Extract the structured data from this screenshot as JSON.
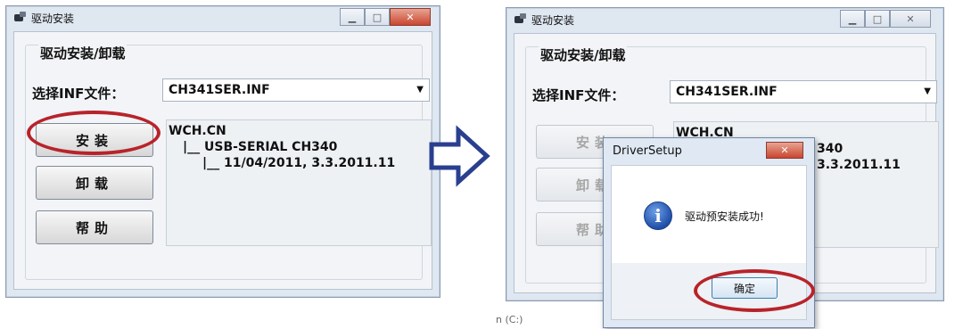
{
  "left_window": {
    "title": "驱动安装",
    "group_title": "驱动安装/卸载",
    "inf_label": "选择INF文件：",
    "inf_value": "CH341SER.INF",
    "buttons": [
      "安装",
      "卸载",
      "帮助"
    ],
    "tree": [
      "WCH.CN",
      "|__ USB-SERIAL CH340",
      "|__ 11/04/2011, 3.3.2011.11"
    ]
  },
  "right_window": {
    "title": "驱动安装",
    "group_title": "驱动安装/卸载",
    "inf_label": "选择INF文件：",
    "inf_value": "CH341SER.INF",
    "buttons": [
      "安装",
      "卸载",
      "帮助"
    ],
    "tree": [
      "WCH.CN",
      "340",
      "3.3.2011.11"
    ]
  },
  "dialog": {
    "title": "DriverSetup",
    "message": "驱动预安装成功!",
    "ok_label": "确定",
    "icon": "info-icon"
  },
  "background_fragment": "n (C:)",
  "colors": {
    "highlight_ellipse": "#b8232a",
    "arrow": "#2a3f8f",
    "window_frame": "#dfe7f1"
  }
}
